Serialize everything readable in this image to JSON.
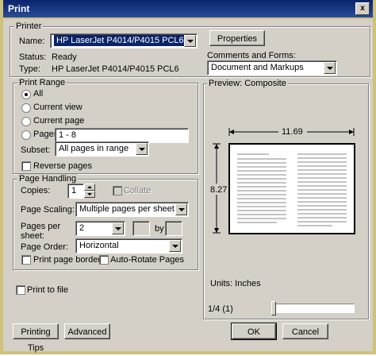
{
  "window": {
    "title": "Print",
    "close_glyph": "x"
  },
  "printer": {
    "group_label": "Printer",
    "name_label": "Name:",
    "name_value": "HP LaserJet P4014/P4015 PCL6",
    "properties_label": "Properties",
    "status_label": "Status:",
    "status_value": "Ready",
    "type_label": "Type:",
    "type_value": "HP LaserJet P4014/P4015 PCL6",
    "comments_label": "Comments and Forms:",
    "comments_value": "Document and Markups"
  },
  "print_range": {
    "group_label": "Print Range",
    "all_label": "All",
    "current_view_label": "Current view",
    "current_page_label": "Current page",
    "pages_label": "Pages",
    "pages_value": "1 - 8",
    "subset_label": "Subset:",
    "subset_value": "All pages in range",
    "reverse_label": "Reverse pages"
  },
  "page_handling": {
    "group_label": "Page Handling",
    "copies_label": "Copies:",
    "copies_value": "1",
    "collate_label": "Collate",
    "scaling_label": "Page Scaling:",
    "scaling_value": "Multiple pages per sheet",
    "pps_label_1": "Pages per",
    "pps_label_2": "sheet:",
    "pps_value": "2",
    "by_label": "by",
    "order_label": "Page Order:",
    "order_value": "Horizontal",
    "border_label": "Print page border",
    "autorotate_label": "Auto-Rotate Pages"
  },
  "print_to_file_label": "Print to file",
  "preview": {
    "group_label": "Preview: Composite",
    "width_label": "11.69",
    "height_label": "8.27",
    "units_label": "Units: Inches",
    "page_indicator": "1/4 (1)",
    "slider_fraction": 0
  },
  "footer": {
    "printing_tips_label": "Printing Tips",
    "advanced_label": "Advanced",
    "ok_label": "OK",
    "cancel_label": "Cancel"
  }
}
